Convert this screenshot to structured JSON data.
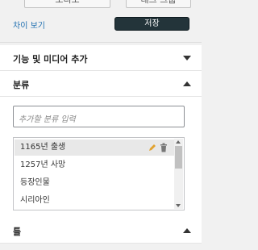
{
  "top_buttons": {
    "left_label": "오디오",
    "right_label": "태그 그룹"
  },
  "diff_link": "차이 보기",
  "save_label": "저장",
  "panels": {
    "features": {
      "title": "기능 및 미디어 추가",
      "arrow": "chevron-down-icon"
    },
    "category": {
      "title": "분류",
      "arrow": "chevron-up-icon"
    },
    "tags": {
      "title": "틀",
      "arrow": "chevron-up-icon"
    }
  },
  "category": {
    "input_placeholder": "추가할 분류 입력",
    "items": [
      {
        "label": "1165년 출생",
        "selected": true
      },
      {
        "label": "1257년 사망",
        "selected": false
      },
      {
        "label": "등장인물",
        "selected": false
      },
      {
        "label": "시리아인",
        "selected": false
      }
    ]
  },
  "colors": {
    "link": "#2271b1",
    "save_button": "#23343a",
    "edit_icon": "#e1a22f"
  }
}
